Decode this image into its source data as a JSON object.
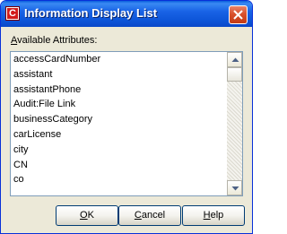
{
  "window": {
    "title": "Information Display List",
    "icon": "app-c-icon"
  },
  "title_bar": {
    "close_icon": "close-x-icon"
  },
  "available_label": {
    "mnemonic": "A",
    "rest": "vailable Attributes:"
  },
  "attributes_list": {
    "items": [
      "accessCardNumber",
      "assistant",
      "assistantPhone",
      "Audit:File Link",
      "businessCategory",
      "carLicense",
      "city",
      "CN",
      "co"
    ]
  },
  "scrollbar": {
    "up_icon": "arrow-up-icon",
    "down_icon": "arrow-down-icon"
  },
  "buttons": {
    "ok": {
      "mnemonic": "O",
      "rest": "K"
    },
    "cancel": {
      "mnemonic": "C",
      "rest": "ancel"
    },
    "help": {
      "mnemonic": "H",
      "rest": "elp"
    }
  },
  "colors": {
    "title_bar_blue": "#0d55d8",
    "dialog_background": "#ece9d8",
    "close_button_red": "#d9512c",
    "list_border": "#7f9db9"
  }
}
